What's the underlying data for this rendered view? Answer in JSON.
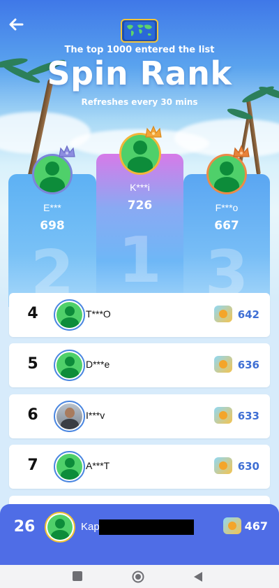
{
  "header": {
    "subtitle": "The top 1000 entered the list",
    "title": "Spin Rank",
    "refresh_note": "Refreshes every 30 mins"
  },
  "podium": [
    {
      "rank": "1",
      "name": "K***i",
      "score": "726",
      "crown_color": "#f2a53a"
    },
    {
      "rank": "2",
      "name": "E***",
      "score": "698",
      "crown_color": "#8c8de0"
    },
    {
      "rank": "3",
      "name": "F***o",
      "score": "667",
      "crown_color": "#e8823a"
    }
  ],
  "ranking": [
    {
      "rank": "4",
      "name": "T***O",
      "score": "642",
      "avatar": "default"
    },
    {
      "rank": "5",
      "name": "D***e",
      "score": "636",
      "avatar": "default"
    },
    {
      "rank": "6",
      "name": "I***v",
      "score": "633",
      "avatar": "photo"
    },
    {
      "rank": "7",
      "name": "A***T",
      "score": "630",
      "avatar": "default"
    }
  ],
  "my_rank": {
    "rank": "26",
    "name": "Kap",
    "score": "467"
  },
  "icons": {
    "back": "back-arrow-icon",
    "globe": "world-map-icon",
    "score": "coin-chest-icon"
  },
  "colors": {
    "accent": "#4f6de6",
    "score_text": "#3f6fd4",
    "avatar_green": "#4fd06a"
  }
}
